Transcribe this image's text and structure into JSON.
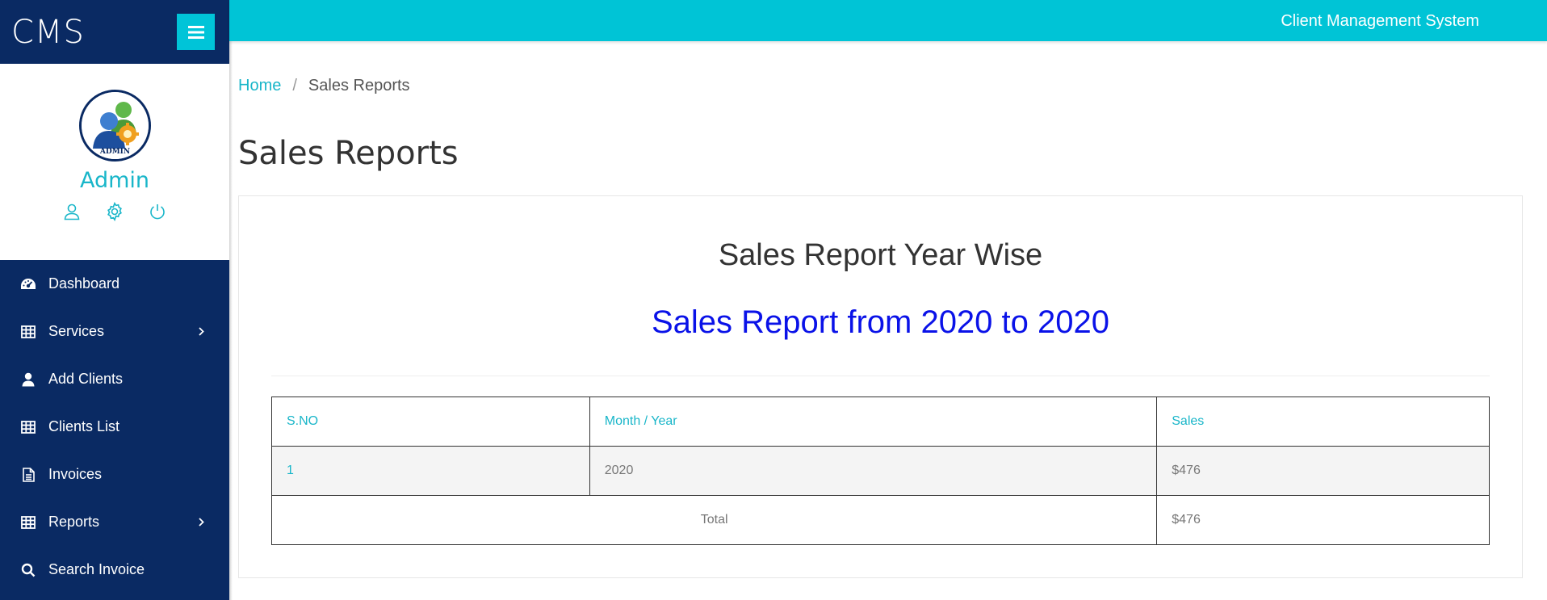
{
  "brand": {
    "title": "CMS"
  },
  "profile": {
    "name": "Admin",
    "avatar_badge": "ADMIN"
  },
  "profile_icons": [
    "user-icon",
    "gear-icon",
    "power-icon"
  ],
  "sidebar": {
    "items": [
      {
        "label": "Dashboard",
        "icon": "dashboard-icon",
        "has_submenu": false
      },
      {
        "label": "Services",
        "icon": "table-icon",
        "has_submenu": true
      },
      {
        "label": "Add Clients",
        "icon": "user-icon",
        "has_submenu": false
      },
      {
        "label": "Clients List",
        "icon": "table-icon",
        "has_submenu": false
      },
      {
        "label": "Invoices",
        "icon": "file-icon",
        "has_submenu": false
      },
      {
        "label": "Reports",
        "icon": "table-icon",
        "has_submenu": true
      },
      {
        "label": "Search Invoice",
        "icon": "search-icon",
        "has_submenu": false
      }
    ]
  },
  "topbar": {
    "title": "Client Management System"
  },
  "breadcrumb": {
    "home": "Home",
    "separator": "/",
    "current": "Sales Reports"
  },
  "page": {
    "title": "Sales Reports"
  },
  "report": {
    "title": "Sales Report Year Wise",
    "subtitle": "Sales Report from 2020 to 2020",
    "table": {
      "headers": [
        "S.NO",
        "Month / Year",
        "Sales"
      ],
      "rows": [
        {
          "sno": "1",
          "period": "2020",
          "sales": "$476"
        }
      ],
      "total_label": "Total",
      "total_value": "$476"
    }
  },
  "colors": {
    "sidebar_bg": "#0a2a63",
    "accent": "#00c4d6",
    "subtitle_blue": "#0a12e8"
  }
}
